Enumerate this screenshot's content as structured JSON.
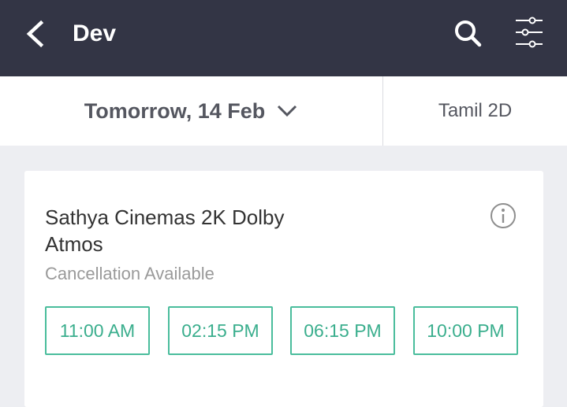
{
  "header": {
    "title": "Dev",
    "back_icon": "back-arrow-icon",
    "search_icon": "search-icon",
    "filter_icon": "filter-sliders-icon"
  },
  "subheader": {
    "date_label": "Tomorrow, 14 Feb",
    "format_label": "Tamil 2D"
  },
  "cinema": {
    "name": "Sathya Cinemas 2K Dolby Atmos",
    "note": "Cancellation Available",
    "showtimes": [
      "11:00 AM",
      "02:15 PM",
      "06:15 PM",
      "10:00 PM"
    ]
  },
  "colors": {
    "header_bg": "#333545",
    "accent": "#4abd9c",
    "page_bg": "#edeef2"
  }
}
